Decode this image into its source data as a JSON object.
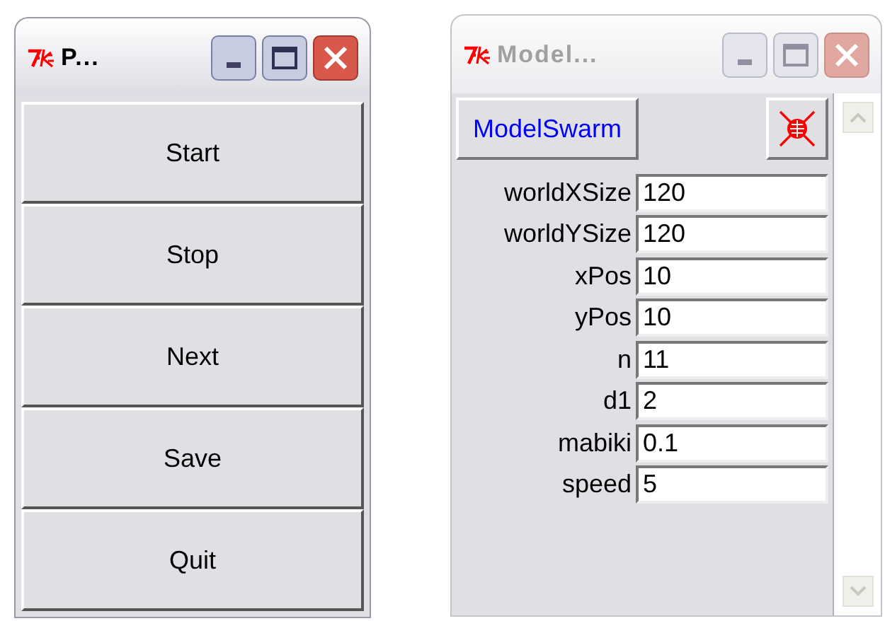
{
  "windows": [
    {
      "title": "P...",
      "active": true,
      "buttons": [
        "Start",
        "Stop",
        "Next",
        "Save",
        "Quit"
      ]
    },
    {
      "title": "Model...",
      "active": false,
      "header_button": "ModelSwarm",
      "fields": [
        {
          "label": "worldXSize",
          "value": "120"
        },
        {
          "label": "worldYSize",
          "value": "120"
        },
        {
          "label": "xPos",
          "value": "10"
        },
        {
          "label": "yPos",
          "value": "10"
        },
        {
          "label": "n",
          "value": "11"
        },
        {
          "label": "d1",
          "value": "2"
        },
        {
          "label": "mabiki",
          "value": "0.1"
        },
        {
          "label": "speed",
          "value": "5"
        }
      ]
    }
  ]
}
